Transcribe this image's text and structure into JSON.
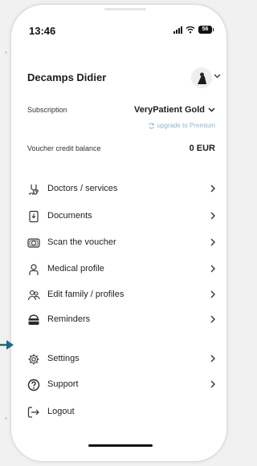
{
  "status_bar": {
    "time": "13:46",
    "battery": "56"
  },
  "account": {
    "user_name": "Decamps Didier",
    "subscription_label": "Subscription",
    "subscription_value": "VeryPatient Gold",
    "upgrade_link": "upgrade to Premium",
    "voucher_label": "Voucher credit balance",
    "voucher_value": "0 EUR"
  },
  "menu": {
    "doctors": "Doctors / services",
    "documents": "Documents",
    "scan": "Scan the voucher",
    "medical": "Medical profile",
    "family": "Edit family / profiles",
    "reminders": "Reminders",
    "settings": "Settings",
    "support": "Support",
    "logout": "Logout"
  },
  "colors": {
    "text": "#1f1f1f",
    "upgrade_link": "#8fb6cf",
    "pointer_arrow": "#1d6a86"
  }
}
